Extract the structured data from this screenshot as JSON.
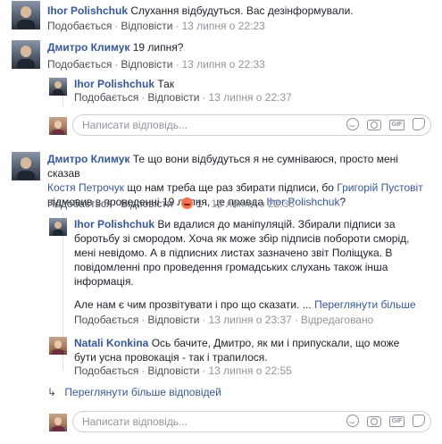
{
  "actions": {
    "like": "Подобається",
    "reply": "Відповісти",
    "dot": "·",
    "edited": "Відредаговано"
  },
  "comments": [
    {
      "author": "Ihor Polishchuk",
      "text": "Слухання відбудуться. Вас дезінформували.",
      "time": "13 липня о 22:23"
    },
    {
      "author": "Дмитро Климук",
      "text": "19 липня?",
      "time": "13 липня о 22:33",
      "replies": [
        {
          "author": "Ihor Polishchuk",
          "text": "Так",
          "time": "13 липня о 22:37"
        }
      ]
    },
    {
      "author": "Дмитро Климук",
      "text_lines": [
        "Те що вони відбудуться я не сумніваюся, просто мені сказав",
        "що нам треба ще раз збирати підписи, бо",
        "відмовив в проведенні 19 липня, це правда",
        "?"
      ],
      "mentions": [
        "Костя Петрочук",
        "Григорій Пустовіт",
        "Ihor Polishchuk"
      ],
      "reaction_count": "1",
      "time": "13 липня о 22:38",
      "replies": [
        {
          "author": "Ihor Polishchuk",
          "text_lines": [
            "Ви вдалися до маніпуляцій. Збирали підписи за",
            "боротьбу зі смородом. Хоча як може збір підписів побороти сморід,",
            "мені невідомо. А в підписних листах зазначено звіт Поліщука. В",
            "повідомленні про проведення громадських слухань також інша",
            "інформація."
          ],
          "text_tail": "Але нам є чим прозвітувати і про що сказати. ...",
          "see_more": "Переглянути більше",
          "time": "13 липня о 23:37"
        },
        {
          "author": "Natali Konkina",
          "text_lines": [
            "Ось бачите, Дмитро, як ми і припускали, що може",
            "бути усна провокація - так і трапилося."
          ],
          "time": "13 липня о 22:55"
        }
      ],
      "more_replies": "Переглянути більше відповідей"
    }
  ],
  "reply_placeholder": "Написати відповідь..."
}
